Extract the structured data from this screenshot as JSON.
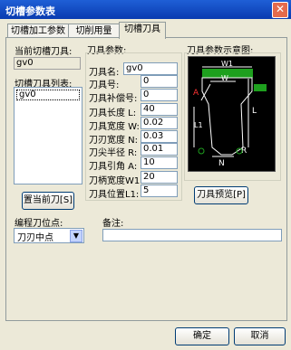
{
  "window": {
    "title": "切槽参数表",
    "close": "✕"
  },
  "tabs": [
    {
      "label": "切槽加工参数"
    },
    {
      "label": "切削用量"
    },
    {
      "label": "切槽刀具"
    }
  ],
  "left": {
    "current_tool_label": "当前切槽刀具:",
    "current_tool_value": "gv0",
    "tool_list_label": "切槽刀具列表:",
    "tool_list_items": [
      "gv0"
    ],
    "set_current_button": "置当前刀[S]"
  },
  "params": {
    "section_label": "刀具参数:",
    "fields": [
      {
        "label": "刀具名:",
        "value": "gv0"
      },
      {
        "label": "刀具号:",
        "value": "0"
      },
      {
        "label": "刀具补偿号:",
        "value": "0"
      },
      {
        "label": "刀具长度 L:",
        "value": "40"
      },
      {
        "label": "刀具宽度 W:",
        "value": "0.02"
      },
      {
        "label": "刀刃宽度 N:",
        "value": "0.03"
      },
      {
        "label": "刀尖半径 R:",
        "value": "0.01"
      },
      {
        "label": "刀具引角 A:",
        "value": "10"
      },
      {
        "label": "刀柄宽度W1:",
        "value": "20"
      },
      {
        "label": "刀具位置L1:",
        "value": "5"
      }
    ]
  },
  "diagram": {
    "label": "刀具参数示意图:",
    "labels": {
      "w1": "W1",
      "w": "W",
      "a": "A",
      "l": "L",
      "l1": "L1",
      "n": "N",
      "r": "R"
    },
    "preview_button": "刀具预览[P]"
  },
  "bottom": {
    "tool_point_label": "编程刀位点:",
    "tool_point_value": "刀刃中点",
    "note_label": "备注:",
    "note_value": ""
  },
  "footer": {
    "ok": "确定",
    "cancel": "取消"
  }
}
